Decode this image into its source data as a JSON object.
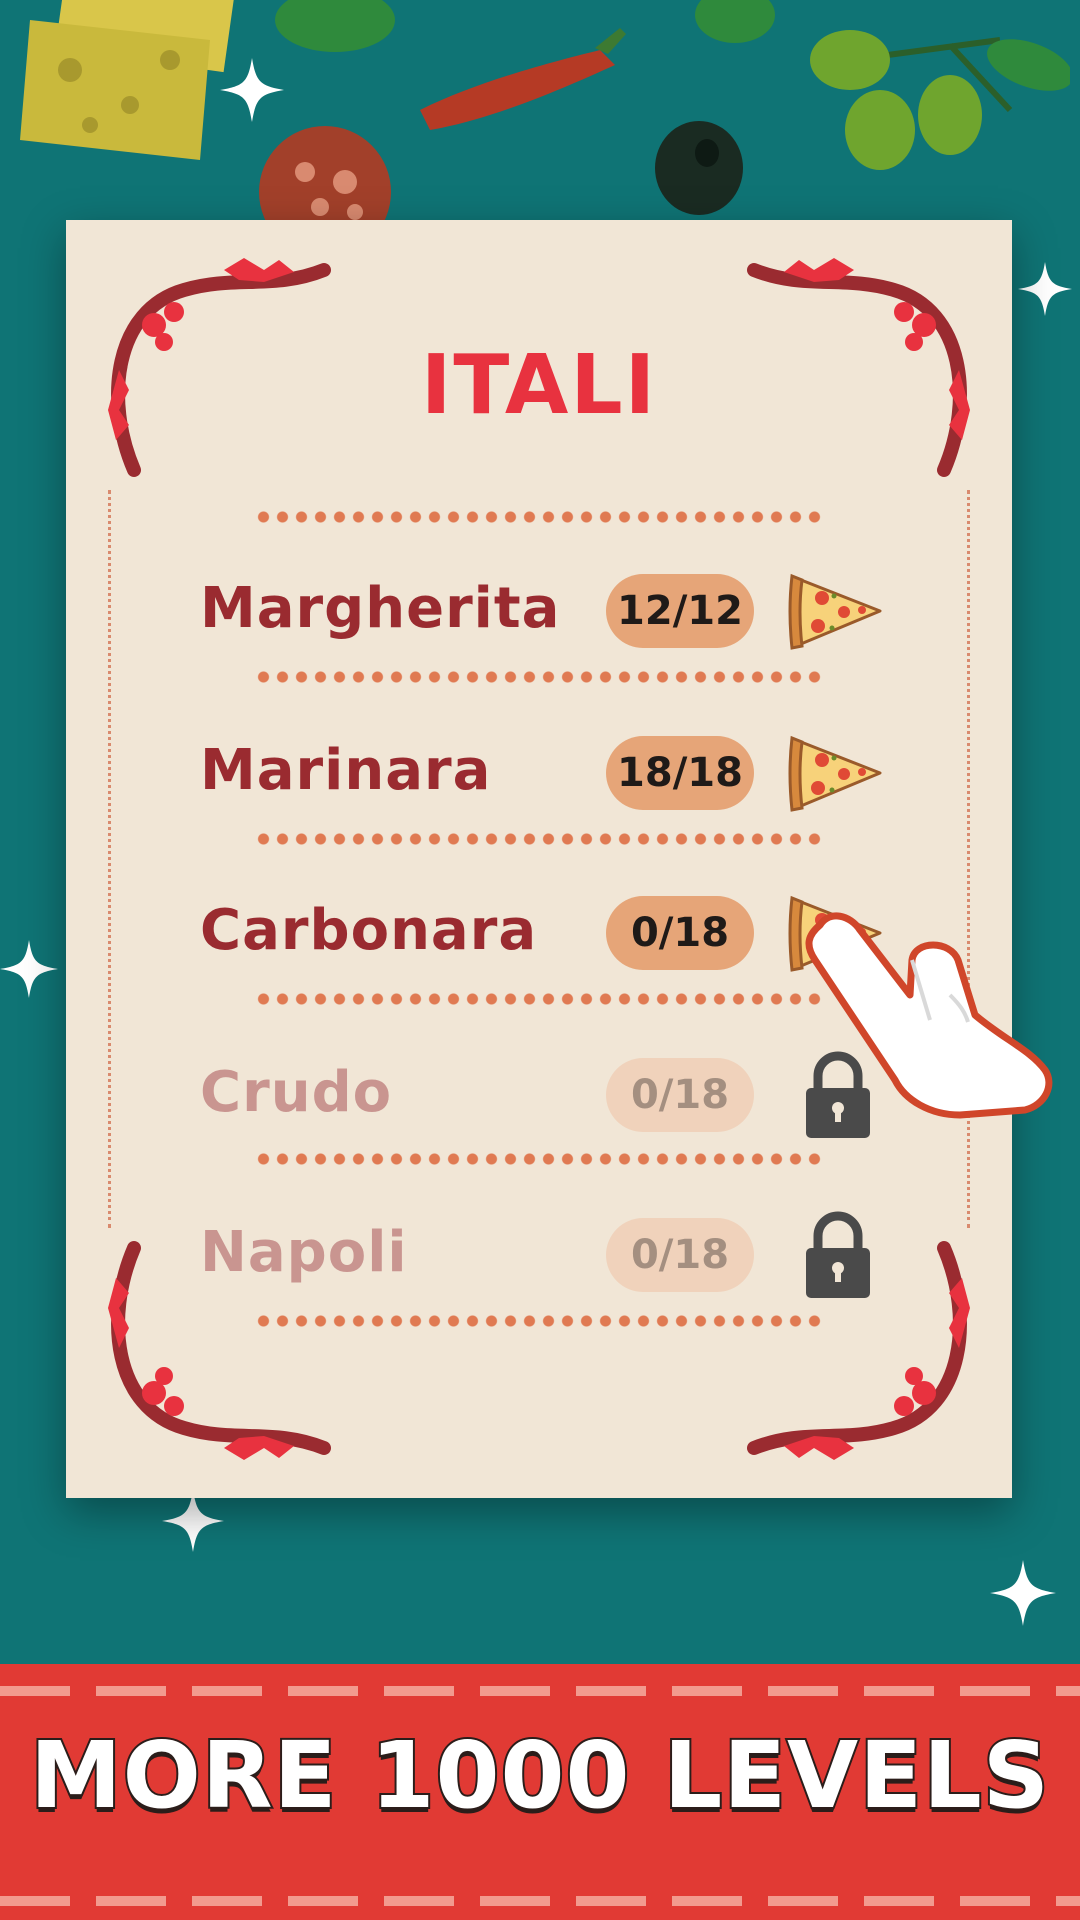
{
  "menu": {
    "title": "ITALI",
    "items": [
      {
        "name": "Margherita",
        "progress": "12/12",
        "icon": "pizza-slice-icon",
        "locked": false
      },
      {
        "name": "Marinara",
        "progress": "18/18",
        "icon": "pizza-slice-icon",
        "locked": false
      },
      {
        "name": "Carbonara",
        "progress": "0/18",
        "icon": "pizza-slice-icon",
        "locked": false
      },
      {
        "name": "Crudo",
        "progress": "0/18",
        "icon": "lock-icon",
        "locked": true
      },
      {
        "name": "Napoli",
        "progress": "0/18",
        "icon": "lock-icon",
        "locked": true
      }
    ]
  },
  "banner": {
    "text": "MORE 1000 LEVELS"
  },
  "colors": {
    "background": "#0f7475",
    "card": "#f1e6d6",
    "title": "#e8323f",
    "item_name": "#9a2b30",
    "badge": "#e6a578",
    "banner": "#e13a34"
  }
}
